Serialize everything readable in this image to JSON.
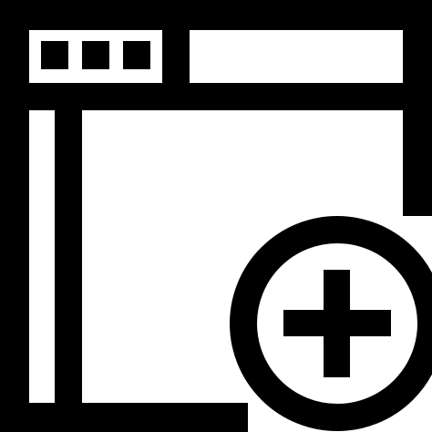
{
  "icon": {
    "name": "add-browser-window-icon",
    "parts": [
      "browser-window-icon",
      "window-control-dots-icon",
      "sidebar-panel-icon",
      "add-circle-icon",
      "plus-icon"
    ]
  },
  "colors": {
    "stroke": "#000000",
    "background": "#ffffff"
  }
}
